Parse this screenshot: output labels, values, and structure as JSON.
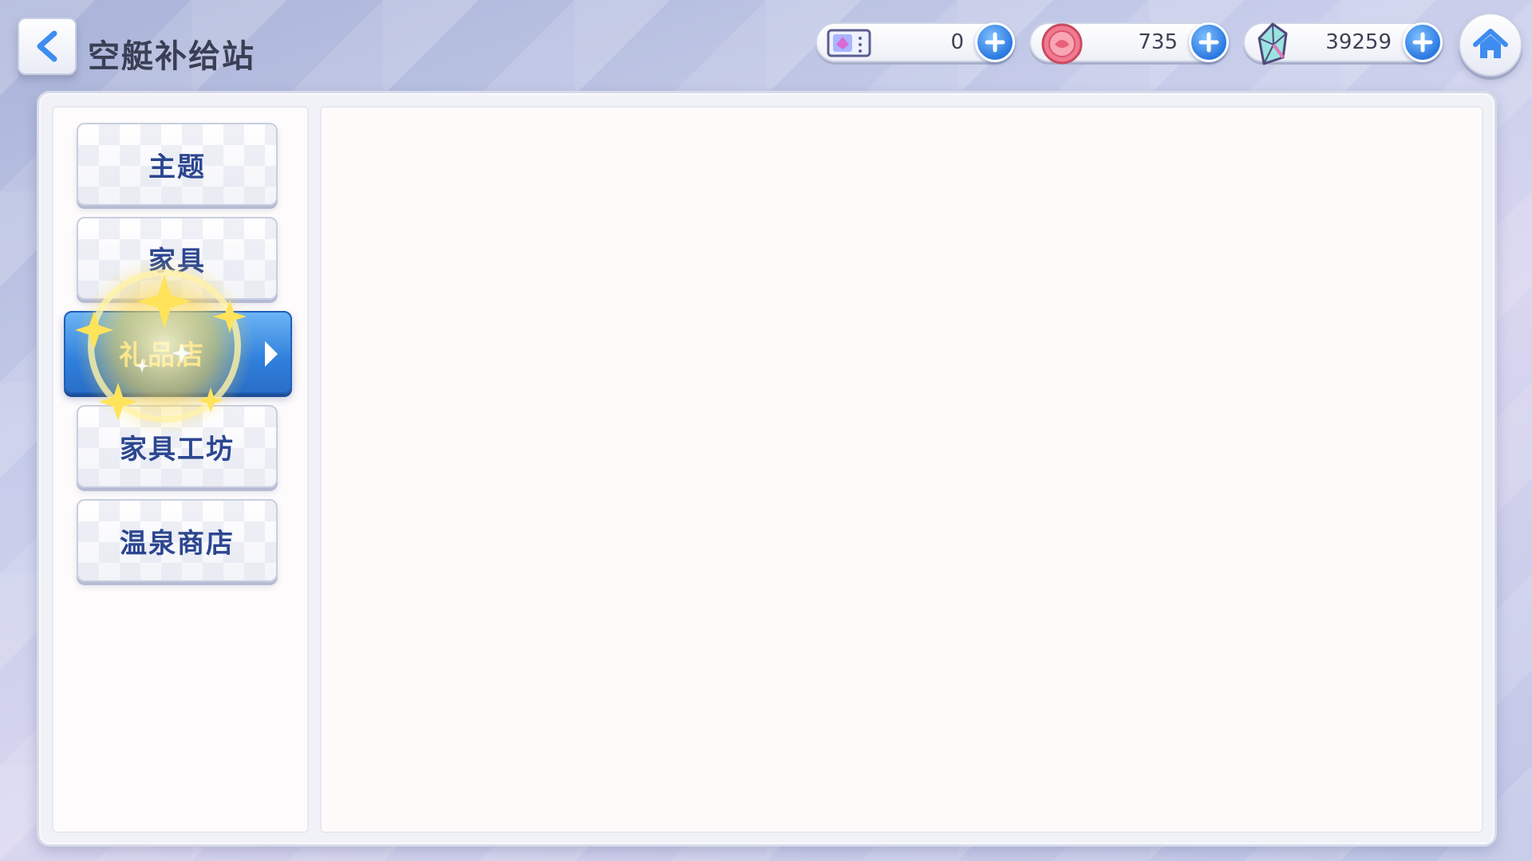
{
  "header": {
    "title": "空艇补给站"
  },
  "currencies": [
    {
      "icon": "ticket-icon",
      "amount": "0"
    },
    {
      "icon": "coin-icon",
      "amount": "735"
    },
    {
      "icon": "crystal-icon",
      "amount": "39259"
    }
  ],
  "sidebar": {
    "tabs": [
      {
        "label": "主题",
        "active": false
      },
      {
        "label": "家具",
        "active": false
      },
      {
        "label": "礼品店",
        "active": true
      },
      {
        "label": "家具工坊",
        "active": false
      },
      {
        "label": "温泉商店",
        "active": false
      }
    ]
  },
  "colors": {
    "active_tab": "#2f7fdc",
    "tab_text": "#2c4690",
    "plus_button": "#2a78e0"
  }
}
